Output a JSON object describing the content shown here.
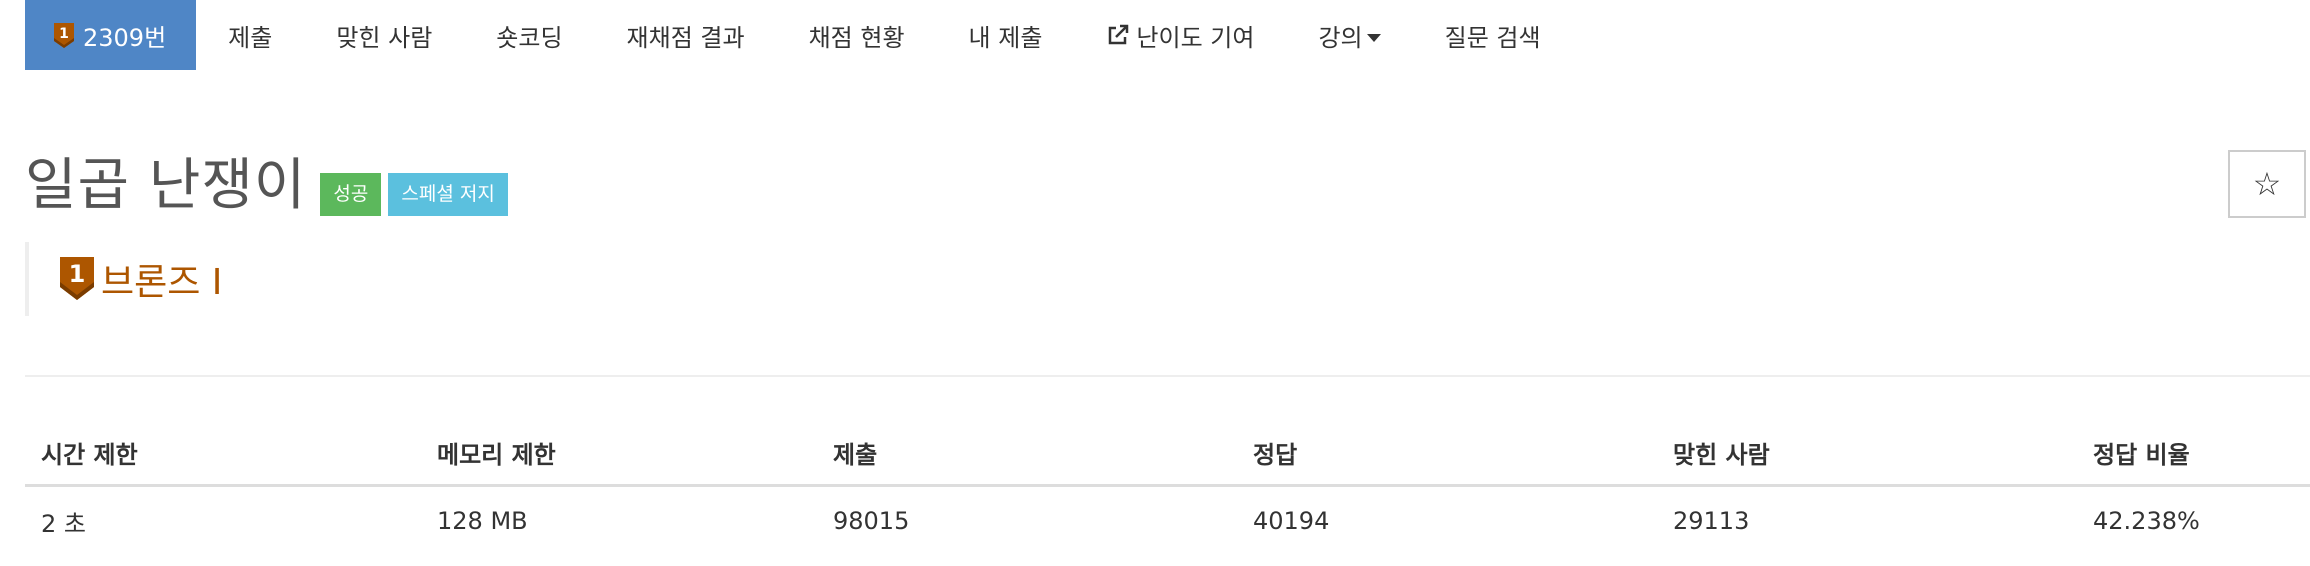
{
  "nav": {
    "problem_number": "2309번",
    "tabs": {
      "submit": "제출",
      "solved_users": "맞힌 사람",
      "short_coding": "숏코딩",
      "rejudge_result": "재채점 결과",
      "judge_status": "채점 현황",
      "my_submissions": "내 제출",
      "difficulty_contribution": "난이도 기여",
      "lectures": "강의",
      "question_search": "질문 검색"
    }
  },
  "problem": {
    "title": "일곱 난쟁이",
    "labels": {
      "success": "성공",
      "special_judge": "스페셜 저지"
    },
    "star_symbol": "☆",
    "tier_text": "브론즈 I",
    "tier_number": "1"
  },
  "info_table": {
    "headers": [
      "시간 제한",
      "메모리 제한",
      "제출",
      "정답",
      "맞힌 사람",
      "정답 비율"
    ],
    "values": [
      "2 초",
      "128 MB",
      "98015",
      "40194",
      "29113",
      "42.238%"
    ]
  },
  "colors": {
    "active_tab": "#4f86c6",
    "bronze": "#ad5600",
    "success_label": "#5cb85c",
    "info_label": "#5bc0de"
  }
}
